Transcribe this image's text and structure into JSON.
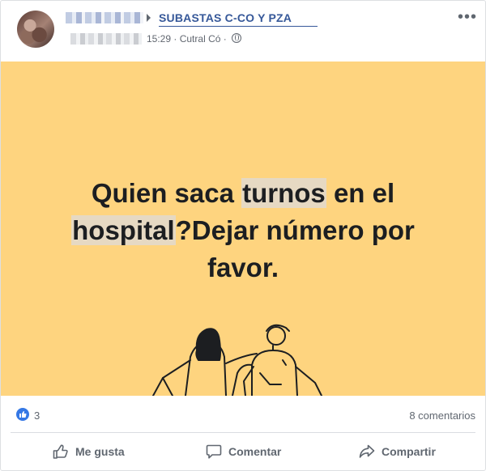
{
  "post": {
    "group_name": "SUBASTAS C-CO Y PZA",
    "time": "15:29",
    "separator": "·",
    "location": "Cutral Có",
    "separator2": "·",
    "text_parts": [
      "Quien saca ",
      "turnos",
      " en el ",
      "hospital",
      "?Dejar número por favor."
    ],
    "background_color": "#fed47f"
  },
  "reactions": {
    "like_count": "3",
    "comments": "8 comentarios",
    "like_color": "#3578e5"
  },
  "actions": {
    "like_label": "Me gusta",
    "comment_label": "Comentar",
    "share_label": "Compartir"
  },
  "icons": [
    "more-options-icon",
    "arrow-right-icon",
    "globe-icon",
    "like-thumb-icon",
    "comment-bubble-icon",
    "share-arrow-icon"
  ]
}
